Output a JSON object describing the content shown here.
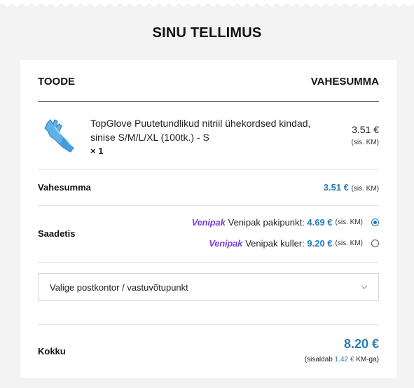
{
  "heading": "SINU TELLIMUS",
  "table": {
    "col_product": "TOODE",
    "col_subtotal": "VAHESUMMA"
  },
  "item": {
    "name": "TopGlove Puutetundlikud nitriil ühekordsed kindad, sinise S/M/L/XL (100tk.) - S",
    "qty": "× 1",
    "price": "3.51 €",
    "vat_note": "(sis. KM)",
    "image_icon": "blue-glove-image"
  },
  "subtotal": {
    "label": "Vahesumma",
    "value": "3.51 €",
    "vat_note": "(sis. KM)"
  },
  "shipping": {
    "label": "Saadetis",
    "options": [
      {
        "logo": "Venipak",
        "name": "Venipak pakipunkt:",
        "price": "4.69 €",
        "vat_note": "(sis. KM)",
        "selected": true
      },
      {
        "logo": "Venipak",
        "name": "Venipak kuller:",
        "price": "9.20 €",
        "vat_note": "(sis. KM)",
        "selected": false
      }
    ]
  },
  "pickup_select": {
    "value": "Valige postkontor / vastuvõtupunkt"
  },
  "total": {
    "label": "Kokku",
    "value": "8.20 €",
    "note_prefix": "(sisaldab",
    "vat_amount": "1.42 €",
    "note_suffix": "KM-ga)"
  },
  "colors": {
    "accent": "#2b7bb9",
    "venipak": "#7b3fd6",
    "radio": "#1a73c9"
  }
}
